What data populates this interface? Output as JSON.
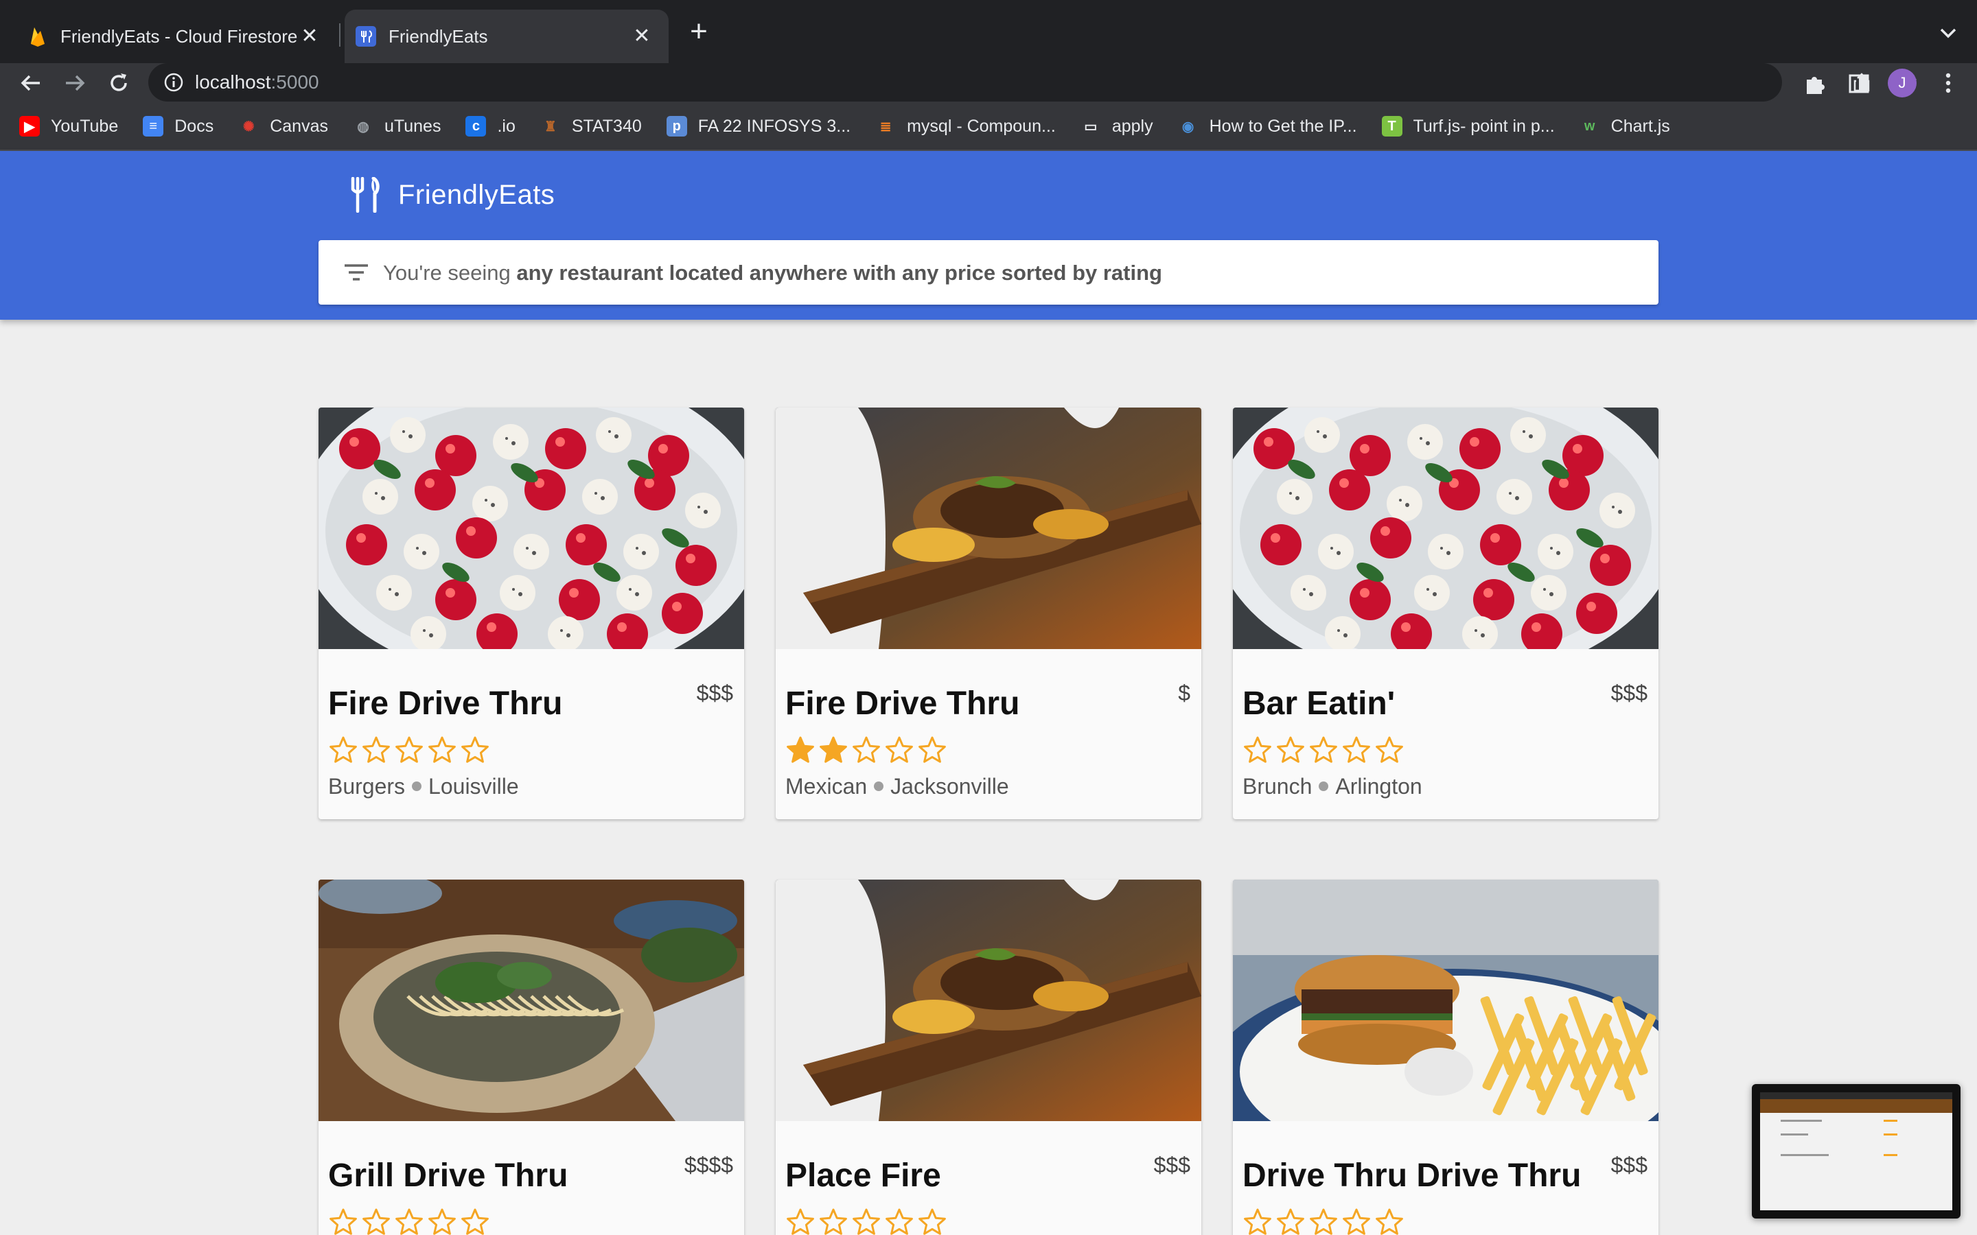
{
  "browser": {
    "tabs": [
      {
        "title": "FriendlyEats - Cloud Firestore",
        "favicon": "firebase-flame-icon",
        "active": false
      },
      {
        "title": "FriendlyEats",
        "favicon": "friendlyeats-icon",
        "active": true
      }
    ],
    "url_host": "localhost",
    "url_port": ":5000",
    "profile_initial": "J",
    "bookmarks": [
      {
        "label": "YouTube",
        "icon": "youtube-icon",
        "color": "#ff0000"
      },
      {
        "label": "Docs",
        "icon": "docs-icon",
        "color": "#4285f4"
      },
      {
        "label": "Canvas",
        "icon": "canvas-icon",
        "color": "#e03c31"
      },
      {
        "label": "uTunes",
        "icon": "globe-icon",
        "color": "#9aa0a6"
      },
      {
        "label": ".io",
        "icon": "c-logo-icon",
        "color": "#1a73e8"
      },
      {
        "label": "STAT340",
        "icon": "crest-icon",
        "color": "#b5652b"
      },
      {
        "label": "FA 22 INFOSYS 3...",
        "icon": "p-logo-icon",
        "color": "#5b8bd6"
      },
      {
        "label": "mysql - Compoun...",
        "icon": "stackoverflow-icon",
        "color": "#f48024"
      },
      {
        "label": "apply",
        "icon": "folder-icon",
        "color": "#e8eaed"
      },
      {
        "label": "How to Get the IP...",
        "icon": "location-icon",
        "color": "#4a90d9"
      },
      {
        "label": "Turf.js- point in p...",
        "icon": "turf-icon",
        "color": "#7dc242"
      },
      {
        "label": "Chart.js",
        "icon": "w-logo-icon",
        "color": "#5cb85c"
      }
    ]
  },
  "app": {
    "brand": "FriendlyEats",
    "filter": {
      "prefix": "You're seeing ",
      "description": "any restaurant located anywhere with any price sorted by rating"
    },
    "accent_color": "#3f6ad8",
    "star_color": "#f5a623",
    "restaurants": [
      {
        "name": "Fire Drive Thru",
        "price": "$$$",
        "rating": 0,
        "category": "Burgers",
        "city": "Louisville",
        "photo": "caprese-salad"
      },
      {
        "name": "Fire Drive Thru",
        "price": "$",
        "rating": 2,
        "category": "Mexican",
        "city": "Jacksonville",
        "photo": "grilled-dish-board"
      },
      {
        "name": "Bar Eatin'",
        "price": "$$$",
        "rating": 0,
        "category": "Brunch",
        "city": "Arlington",
        "photo": "caprese-salad"
      },
      {
        "name": "Grill Drive Thru",
        "price": "$$$$",
        "rating": 0,
        "category": "",
        "city": "",
        "photo": "noodle-bowl"
      },
      {
        "name": "Place Fire",
        "price": "$$$",
        "rating": 0,
        "category": "",
        "city": "",
        "photo": "grilled-dish-board"
      },
      {
        "name": "Drive Thru Drive Thru",
        "price": "$$$",
        "rating": 0,
        "category": "",
        "city": "",
        "photo": "burger-fries"
      }
    ]
  }
}
